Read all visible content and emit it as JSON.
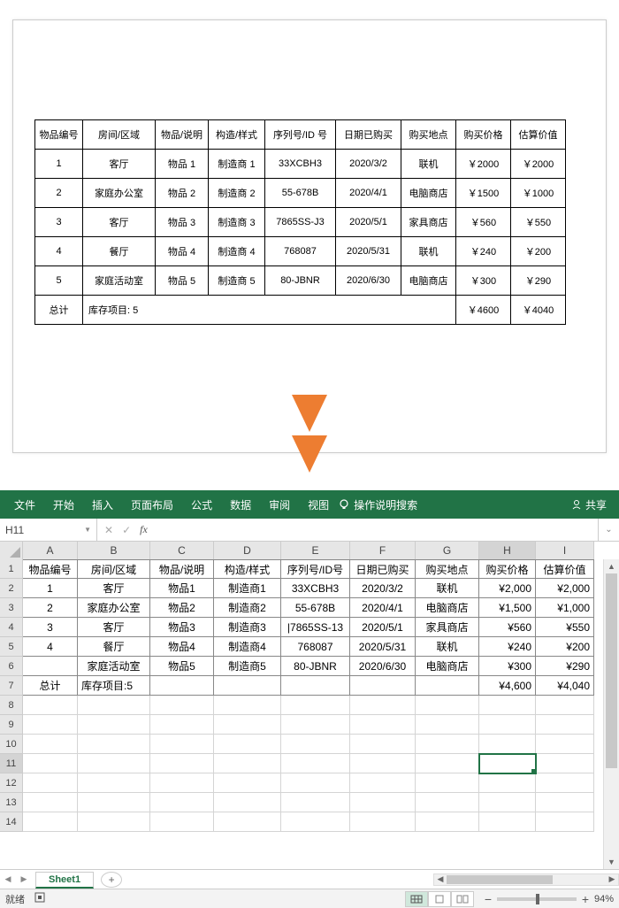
{
  "doc_table": {
    "headers": [
      "物品编号",
      "房间/区域",
      "物品/说明",
      "构造/样式",
      "序列号/ID 号",
      "日期已购买",
      "购买地点",
      "购买价格",
      "估算价值"
    ],
    "rows": [
      [
        "1",
        "客厅",
        "物品 1",
        "制造商 1",
        "33XCBH3",
        "2020/3/2",
        "联机",
        "￥2000",
        "￥2000"
      ],
      [
        "2",
        "家庭办公室",
        "物品 2",
        "制造商 2",
        "55-678B",
        "2020/4/1",
        "电脑商店",
        "￥1500",
        "￥1000"
      ],
      [
        "3",
        "客厅",
        "物品 3",
        "制造商 3",
        "7865SS-J3",
        "2020/5/1",
        "家具商店",
        "￥560",
        "￥550"
      ],
      [
        "4",
        "餐厅",
        "物品 4",
        "制造商 4",
        "768087",
        "2020/5/31",
        "联机",
        "￥240",
        "￥200"
      ],
      [
        "5",
        "家庭活动室",
        "物品 5",
        "制造商 5",
        "80-JBNR",
        "2020/6/30",
        "电脑商店",
        "￥300",
        "￥290"
      ]
    ],
    "total_label": "总计",
    "inventory_label": "库存项目: 5",
    "total_price": "￥4600",
    "total_value": "￥4040"
  },
  "excel": {
    "ribbon": [
      "文件",
      "开始",
      "插入",
      "页面布局",
      "公式",
      "数据",
      "审阅",
      "视图"
    ],
    "tell_me": "操作说明搜索",
    "share": "共享",
    "namebox": "H11",
    "col_letters": [
      "A",
      "B",
      "C",
      "D",
      "E",
      "F",
      "G",
      "H",
      "I"
    ],
    "headers": [
      "物品编号",
      "房间/区域",
      "物品/说明",
      "构造/样式",
      "序列号/ID号",
      "日期已购买",
      "购买地点",
      "购买价格",
      "估算价值"
    ],
    "rows": [
      [
        "1",
        "客厅",
        "物品1",
        "制造商1",
        "33XCBH3",
        "2020/3/2",
        "联机",
        "¥2,000",
        "¥2,000"
      ],
      [
        "2",
        "家庭办公室",
        "物品2",
        "制造商2",
        "55-678B",
        "2020/4/1",
        "电脑商店",
        "¥1,500",
        "¥1,000"
      ],
      [
        "3",
        "客厅",
        "物品3",
        "制造商3",
        "|7865SS-13",
        "2020/5/1",
        "家具商店",
        "¥560",
        "¥550"
      ],
      [
        "4",
        "餐厅",
        "物品4",
        "制造商4",
        "768087",
        "2020/5/31",
        "联机",
        "¥240",
        "¥200"
      ],
      [
        "",
        "家庭活动室",
        "物品5",
        "制造商5",
        "80-JBNR",
        "2020/6/30",
        "电脑商店",
        "¥300",
        "¥290"
      ]
    ],
    "total_label": "总计",
    "inventory_label": "库存项目:5",
    "total_price": "¥4,600",
    "total_value": "¥4,040",
    "sheet_name": "Sheet1",
    "status": "就绪",
    "zoom": "94%"
  },
  "chart_data": {
    "type": "table",
    "title": "物品清单",
    "columns": [
      "物品编号",
      "房间/区域",
      "物品/说明",
      "构造/样式",
      "序列号/ID号",
      "日期已购买",
      "购买地点",
      "购买价格",
      "估算价值"
    ],
    "rows": [
      {
        "物品编号": 1,
        "房间/区域": "客厅",
        "物品/说明": "物品1",
        "构造/样式": "制造商1",
        "序列号/ID号": "33XCBH3",
        "日期已购买": "2020/3/2",
        "购买地点": "联机",
        "购买价格": 2000,
        "估算价值": 2000
      },
      {
        "物品编号": 2,
        "房间/区域": "家庭办公室",
        "物品/说明": "物品2",
        "构造/样式": "制造商2",
        "序列号/ID号": "55-678B",
        "日期已购买": "2020/4/1",
        "购买地点": "电脑商店",
        "购买价格": 1500,
        "估算价值": 1000
      },
      {
        "物品编号": 3,
        "房间/区域": "客厅",
        "物品/说明": "物品3",
        "构造/样式": "制造商3",
        "序列号/ID号": "7865SS-J3",
        "日期已购买": "2020/5/1",
        "购买地点": "家具商店",
        "购买价格": 560,
        "估算价值": 550
      },
      {
        "物品编号": 4,
        "房间/区域": "餐厅",
        "物品/说明": "物品4",
        "构造/样式": "制造商4",
        "序列号/ID号": "768087",
        "日期已购买": "2020/5/31",
        "购买地点": "联机",
        "购买价格": 240,
        "估算价值": 200
      },
      {
        "物品编号": 5,
        "房间/区域": "家庭活动室",
        "物品/说明": "物品5",
        "构造/样式": "制造商5",
        "序列号/ID号": "80-JBNR",
        "日期已购买": "2020/6/30",
        "购买地点": "电脑商店",
        "购买价格": 300,
        "估算价值": 290
      }
    ],
    "totals": {
      "库存项目": 5,
      "购买价格": 4600,
      "估算价值": 4040
    }
  }
}
